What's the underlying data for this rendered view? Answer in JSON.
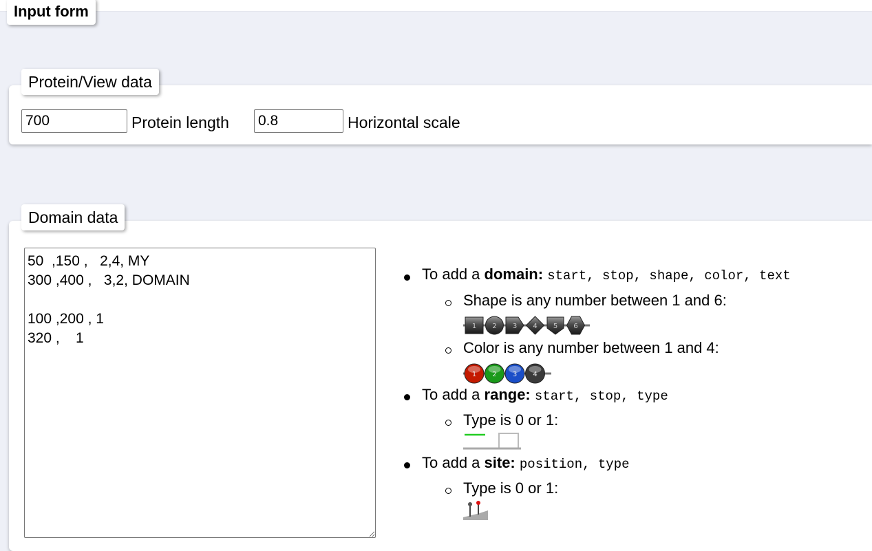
{
  "header": {
    "title": "Input form"
  },
  "protein_section": {
    "title": "Protein/View data",
    "length_value": "700",
    "length_label": "Protein length",
    "scale_value": "0.8",
    "scale_label": "Horizontal scale"
  },
  "domain_section": {
    "title": "Domain data",
    "textarea_value": "50  ,150 ,   2,4, MY\n300 ,400 ,   3,2, DOMAIN\n\n100 ,200 , 1\n320 ,    1"
  },
  "help": {
    "domain": {
      "prefix": "To add a ",
      "keyword": "domain:",
      "fields": "start, stop, shape, color, text"
    },
    "shape_note": "Shape is any number between 1 and 6:",
    "shape_numbers": [
      "1",
      "2",
      "3",
      "4",
      "5",
      "6"
    ],
    "color_note": "Color is any number between 1 and 4:",
    "color_numbers": [
      "1",
      "2",
      "3",
      "4"
    ],
    "range": {
      "prefix": "To add a ",
      "keyword": "range:",
      "fields": "start, stop, type"
    },
    "range_note": "Type is 0 or 1:",
    "site": {
      "prefix": "To add a ",
      "keyword": "site:",
      "fields": "position, type"
    },
    "site_note": "Type is 0 or 1:"
  },
  "colors": {
    "page_bg": "#eef0f7",
    "color1": "#c41a00",
    "color2": "#1a9a1a",
    "color3": "#1a4ec8",
    "color4": "#3a3a3a",
    "range_green": "#22cc22",
    "site_red": "#dd1111"
  }
}
